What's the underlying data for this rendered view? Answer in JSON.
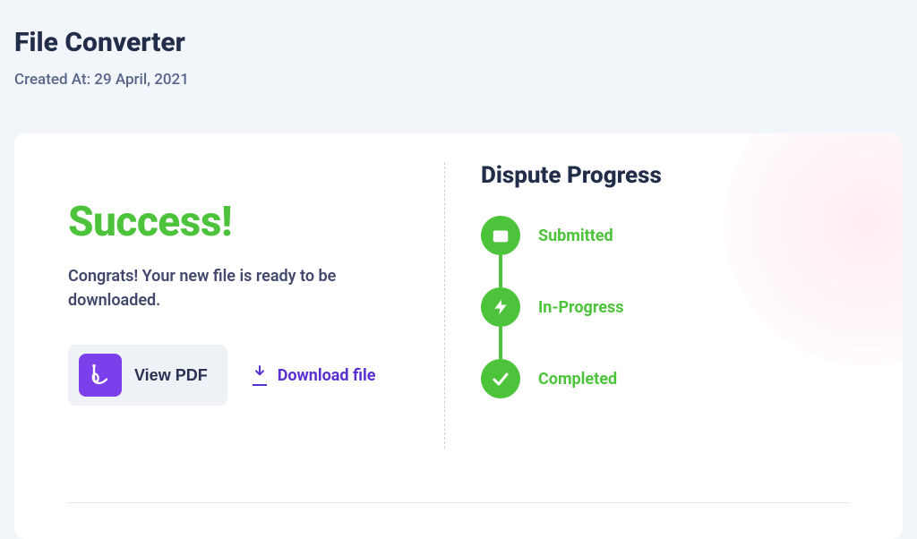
{
  "header": {
    "title": "File Converter",
    "subtitle": "Created At: 29 April, 2021"
  },
  "success": {
    "title": "Success!",
    "message": "Congrats! Your new file is ready to be downloaded."
  },
  "actions": {
    "view_pdf": "View PDF",
    "download": "Download file"
  },
  "progress": {
    "title": "Dispute Progress",
    "steps": {
      "0": {
        "label": "Submitted"
      },
      "1": {
        "label": "In-Progress"
      },
      "2": {
        "label": "Completed"
      }
    }
  }
}
